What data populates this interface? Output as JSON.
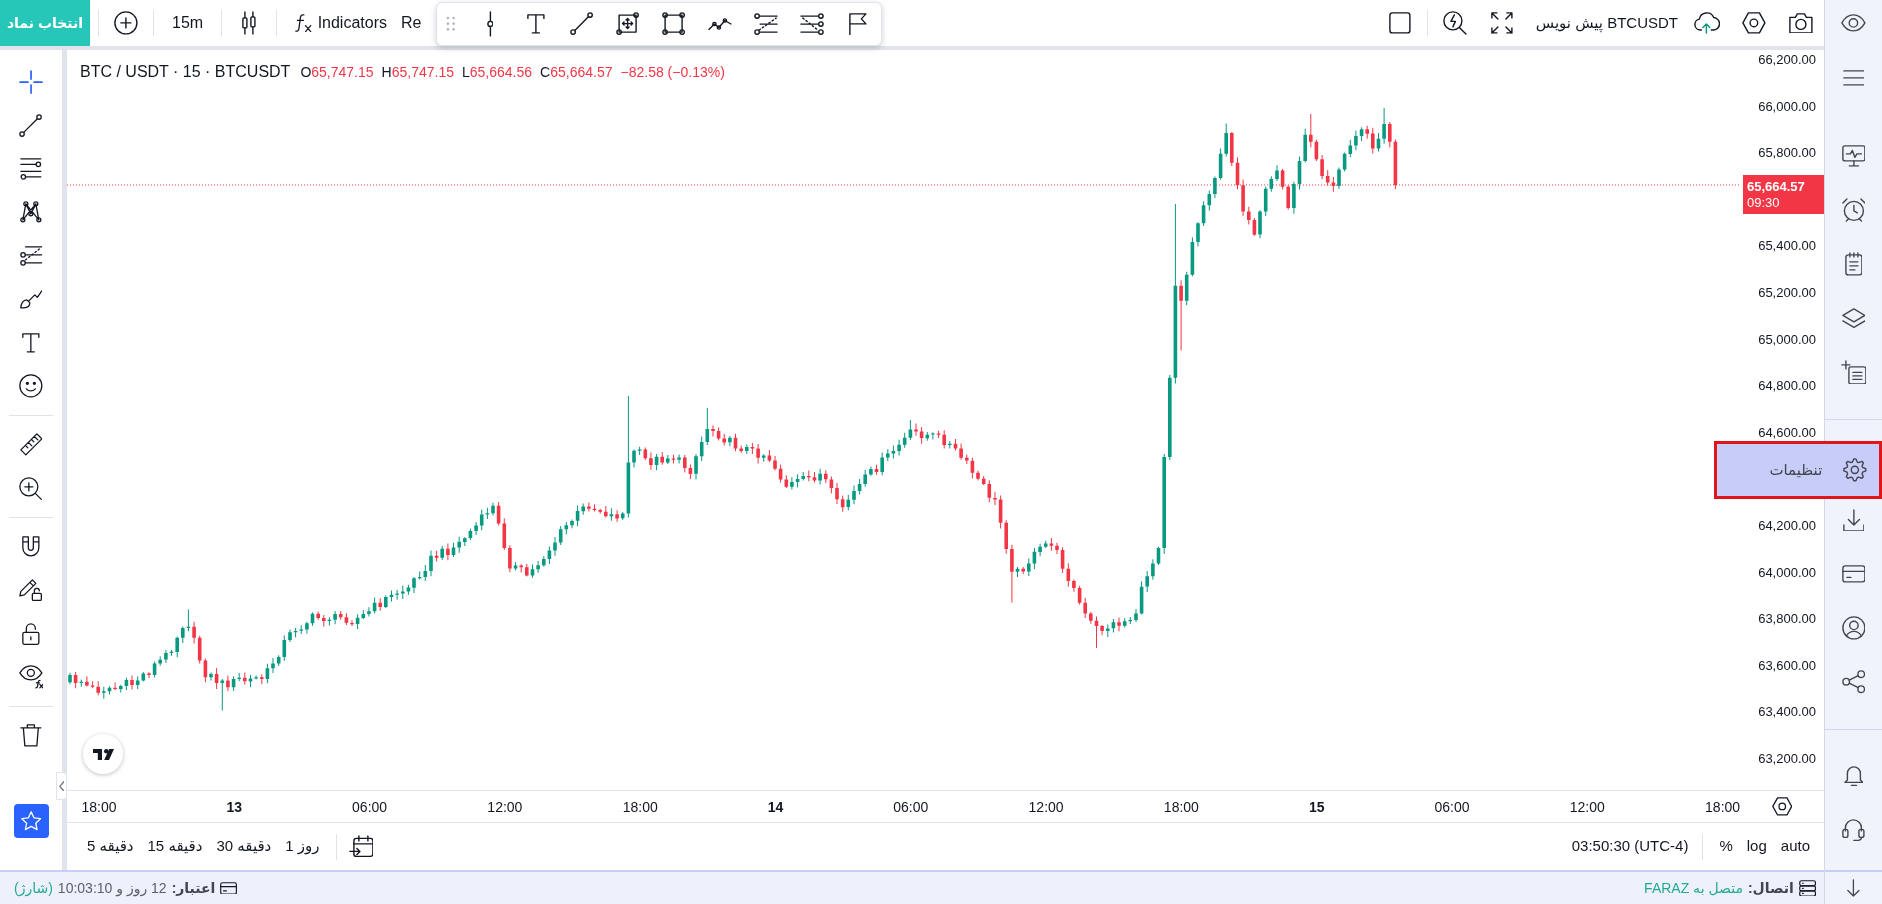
{
  "top_bar": {
    "symbol_button": "انتخاب نماد",
    "left_items": [
      {
        "kind": "separator"
      },
      {
        "kind": "add"
      },
      {
        "kind": "separator"
      },
      {
        "kind": "interval",
        "label": "15m"
      },
      {
        "kind": "separator"
      },
      {
        "kind": "chart-type"
      },
      {
        "kind": "separator"
      },
      {
        "kind": "indicators",
        "label": "Indicators"
      },
      {
        "kind": "text",
        "label": "Re"
      }
    ],
    "right_items": [
      {
        "kind": "layout"
      },
      {
        "kind": "separator"
      },
      {
        "kind": "quick-search"
      },
      {
        "kind": "fullscreen"
      },
      {
        "kind": "layout-name",
        "label": "BTCUSDT پیش نویس"
      },
      {
        "kind": "cloud-save"
      },
      {
        "kind": "chart-settings"
      },
      {
        "kind": "snapshot"
      }
    ]
  },
  "drawing_toolbar": {
    "items": [
      {
        "kind": "grip"
      },
      {
        "kind": "vertical-line"
      },
      {
        "kind": "text"
      },
      {
        "kind": "trend-line"
      },
      {
        "kind": "measure-box"
      },
      {
        "kind": "rectangle"
      },
      {
        "kind": "path"
      },
      {
        "kind": "level-lines"
      },
      {
        "kind": "fan-lines"
      },
      {
        "kind": "flag"
      }
    ]
  },
  "left_toolbar": {
    "tools": [
      {
        "kind": "crosshair",
        "selected": true
      },
      {
        "kind": "trend-line",
        "selected": false
      },
      {
        "kind": "horizontal-lines",
        "selected": false
      },
      {
        "kind": "pattern",
        "selected": false
      },
      {
        "kind": "fib",
        "selected": false
      },
      {
        "kind": "brush",
        "selected": false
      },
      {
        "kind": "text",
        "selected": false
      },
      {
        "kind": "emoji",
        "selected": false
      },
      {
        "kind": "separator"
      },
      {
        "kind": "ruler",
        "selected": false
      },
      {
        "kind": "zoom-in",
        "selected": false
      },
      {
        "kind": "separator"
      },
      {
        "kind": "magnet",
        "selected": false
      },
      {
        "kind": "lock-drawings",
        "selected": false
      },
      {
        "kind": "lock",
        "selected": false
      },
      {
        "kind": "hide",
        "selected": false
      },
      {
        "kind": "separator"
      },
      {
        "kind": "trash",
        "selected": false
      }
    ],
    "favorites": {
      "on": true
    }
  },
  "chart": {
    "header": {
      "title": "BTC / USDT · 15 · BTCUSDT",
      "values": [
        {
          "key": "O",
          "value": "65,747.15"
        },
        {
          "key": "H",
          "value": "65,747.15"
        },
        {
          "key": "L",
          "value": "65,664.56"
        },
        {
          "key": "C",
          "value": "65,664.57"
        }
      ],
      "change": "−82.58 (−0.13%)"
    },
    "price_axis": {
      "labels": [
        "66,200.00",
        "66,000.00",
        "65,800.00",
        "65,400.00",
        "65,200.00",
        "65,000.00",
        "64,800.00",
        "64,600.00",
        "64,200.00",
        "64,000.00",
        "63,800.00",
        "63,600.00",
        "63,400.00",
        "63,200.00"
      ],
      "last_price": {
        "price": "65,664.57",
        "countdown": "09:30"
      }
    },
    "time_axis": {
      "labels": [
        {
          "kind": "time",
          "label": "18:00"
        },
        {
          "kind": "day",
          "label": "13"
        },
        {
          "kind": "time",
          "label": "06:00"
        },
        {
          "kind": "time",
          "label": "12:00"
        },
        {
          "kind": "time",
          "label": "18:00"
        },
        {
          "kind": "day",
          "label": "14"
        },
        {
          "kind": "time",
          "label": "06:00"
        },
        {
          "kind": "time",
          "label": "12:00"
        },
        {
          "kind": "time",
          "label": "18:00"
        },
        {
          "kind": "day",
          "label": "15"
        },
        {
          "kind": "time",
          "label": "06:00"
        },
        {
          "kind": "time",
          "label": "12:00"
        },
        {
          "kind": "time",
          "label": "18:00"
        }
      ]
    }
  },
  "bottom_toolbar": {
    "timeframes": [
      "1 روز",
      "30 دقیقه",
      "15 دقیقه",
      "5 دقیقه"
    ],
    "clock": "03:50:30 (UTC-4)",
    "scale_options": [
      "%",
      "log",
      "auto"
    ]
  },
  "status_bar": {
    "credit": {
      "label": "اعتبار:",
      "value": "12 روز و 10:03:10",
      "note": "(شارژ)"
    },
    "connection": {
      "label": "اتصال:",
      "value": "متصل به FARAZ"
    }
  },
  "right_sidebar": {
    "header_items": [
      {
        "kind": "eye"
      },
      {
        "kind": "menu"
      }
    ],
    "items": [
      {
        "kind": "monitor"
      },
      {
        "kind": "alarm"
      },
      {
        "kind": "notepad"
      },
      {
        "kind": "layers"
      },
      {
        "kind": "list-add"
      },
      {
        "kind": "separator"
      },
      {
        "kind": "settings",
        "label": "تنظیمات"
      },
      {
        "kind": "download"
      },
      {
        "kind": "card"
      },
      {
        "kind": "user"
      },
      {
        "kind": "share"
      },
      {
        "kind": "separator"
      },
      {
        "kind": "bell"
      },
      {
        "kind": "headset"
      }
    ],
    "footer_item": {
      "kind": "arrow-down"
    }
  }
}
